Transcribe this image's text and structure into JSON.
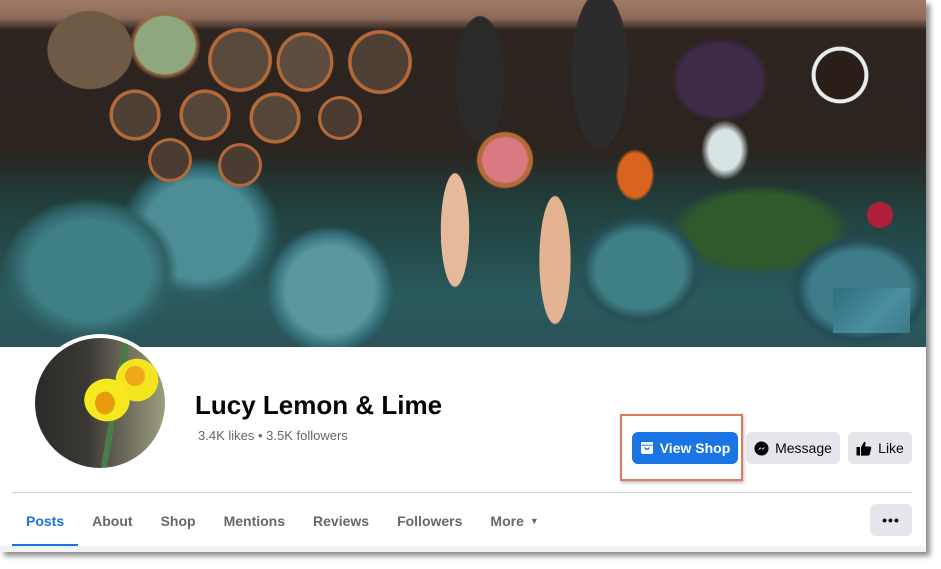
{
  "page": {
    "name": "Lucy Lemon & Lime",
    "stats": "3.4K likes • 3.5K followers",
    "cover_photo": "garden-cover-photo",
    "profile_photo": "daffodil-profile-photo"
  },
  "actions": {
    "view_shop": {
      "label": "View Shop",
      "icon": "shop-bag-icon",
      "highlighted": true
    },
    "message": {
      "label": "Message",
      "icon": "messenger-icon"
    },
    "like": {
      "label": "Like",
      "icon": "thumbs-up-icon"
    }
  },
  "tabs": [
    {
      "label": "Posts",
      "active": true
    },
    {
      "label": "About",
      "active": false
    },
    {
      "label": "Shop",
      "active": false
    },
    {
      "label": "Mentions",
      "active": false
    },
    {
      "label": "Reviews",
      "active": false
    },
    {
      "label": "Followers",
      "active": false
    },
    {
      "label": "More",
      "active": false,
      "dropdown": true
    }
  ],
  "more_options": {
    "label": "•••",
    "icon": "more-options-icon"
  },
  "colors": {
    "primary": "#1b74e4",
    "secondary_button": "#e4e6eb",
    "highlight_border": "#e07a5f",
    "muted_text": "#65676b"
  }
}
